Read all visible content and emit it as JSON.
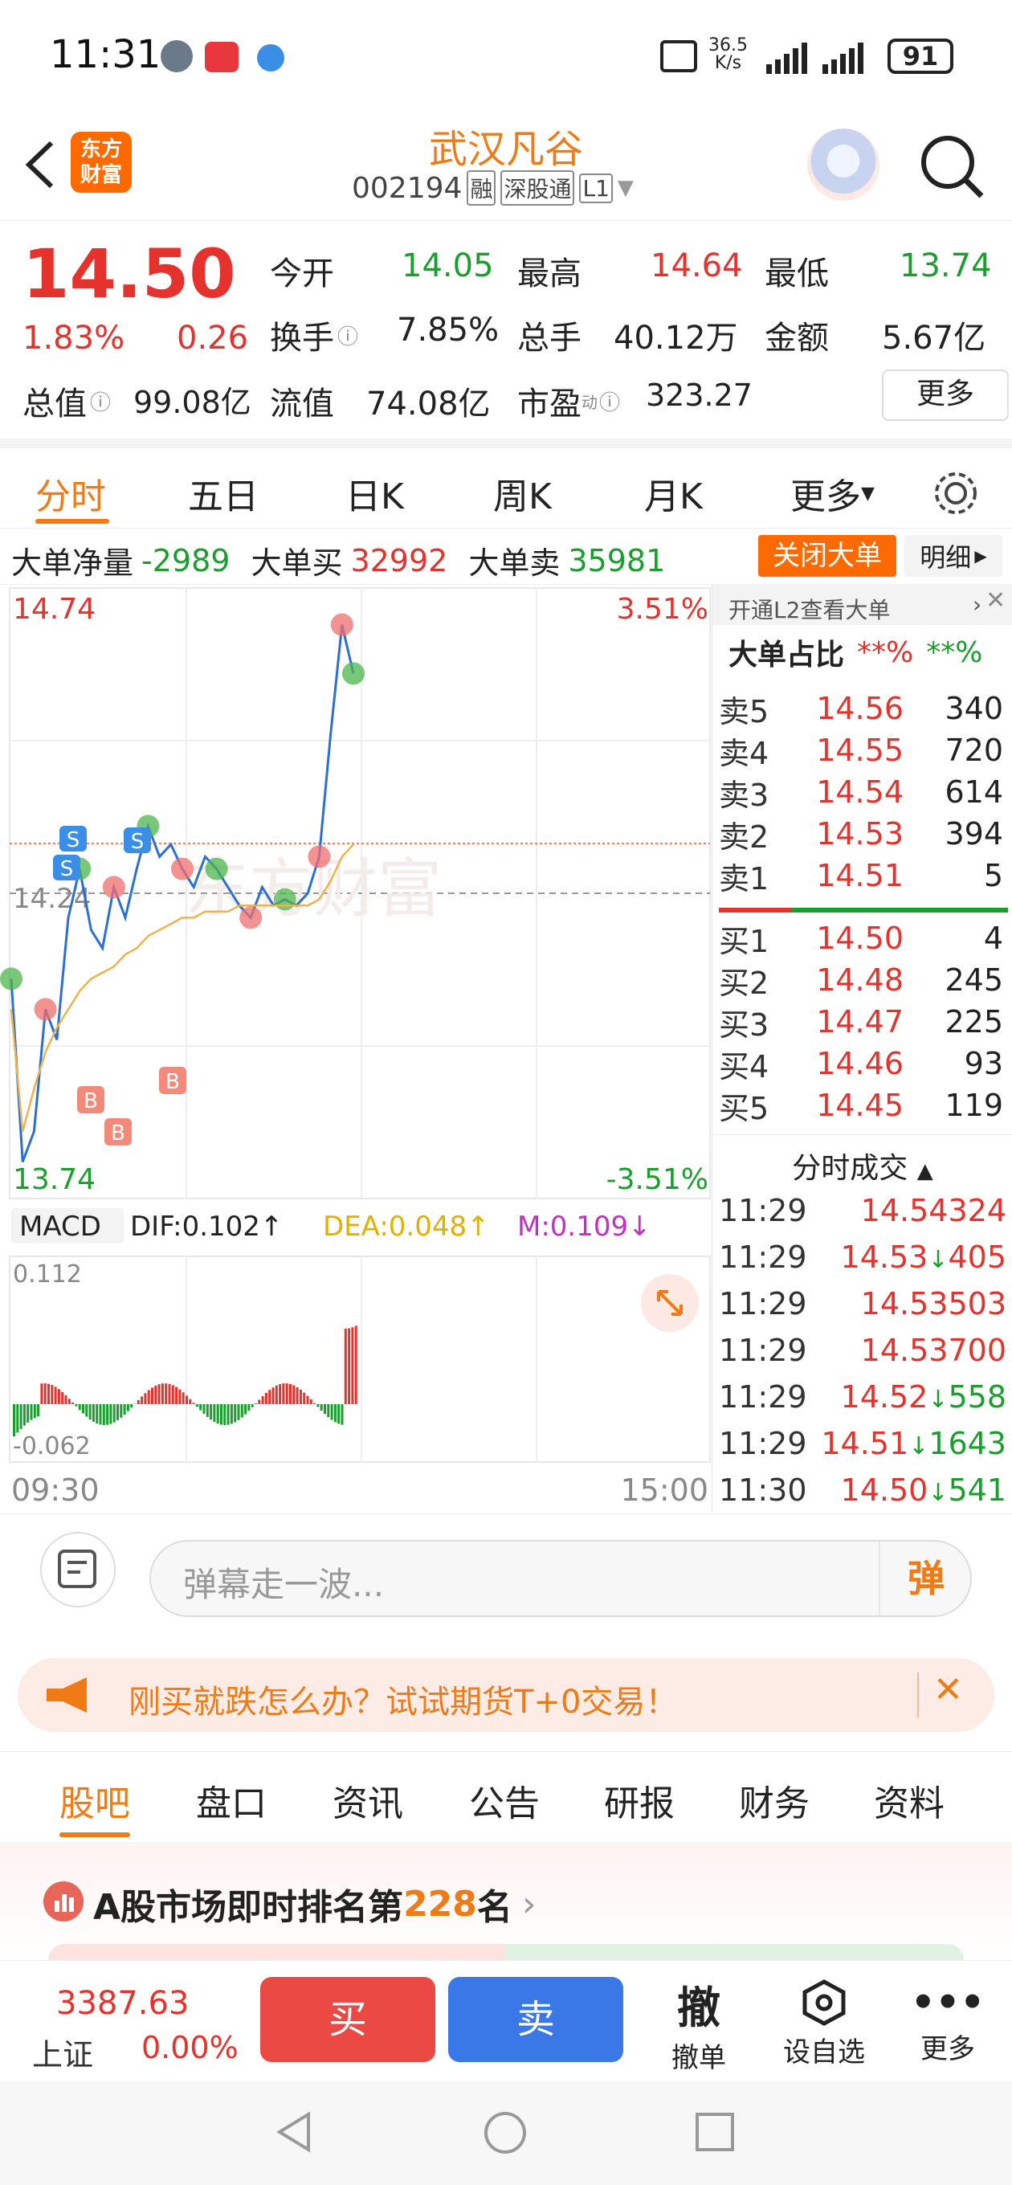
{
  "status": {
    "time": "11:31",
    "net_speed_top": "36.5",
    "net_speed_bottom": "K/s",
    "battery": "91"
  },
  "header": {
    "logo_line1": "东方",
    "logo_line2": "财富",
    "stock_name": "武汉凡谷",
    "stock_code": "002194",
    "tags": [
      "融",
      "深股通",
      "L1"
    ]
  },
  "quote": {
    "price": "14.50",
    "change_pct": "1.83%",
    "change": "0.26",
    "open_label": "今开",
    "open": "14.05",
    "high_label": "最高",
    "high": "14.64",
    "low_label": "最低",
    "low": "13.74",
    "turnover_label": "换手",
    "turnover": "7.85%",
    "volume_label": "总手",
    "volume": "40.12万",
    "amount_label": "金额",
    "amount": "5.67亿",
    "mktcap_label": "总值",
    "mktcap": "99.08亿",
    "float_label": "流值",
    "float": "74.08亿",
    "pe_label": "市盈",
    "pe_sup": "动",
    "pe": "323.27",
    "more": "更多"
  },
  "tabs": [
    "分时",
    "五日",
    "日K",
    "周K",
    "月K",
    "更多"
  ],
  "bigorder": {
    "net_label": "大单净量",
    "net": "-2989",
    "buy_label": "大单买",
    "buy": "32992",
    "sell_label": "大单卖",
    "sell": "35981",
    "close_btn": "关闭大单",
    "detail_btn": "明细"
  },
  "chart": {
    "high_label": "14.74",
    "low_label": "13.74",
    "high_pct": "3.51%",
    "low_pct": "-3.51%",
    "mid_label": "14.24",
    "watermark": "东方财富",
    "start_time": "09:30",
    "end_time": "15:00",
    "macd": {
      "name": "MACD",
      "dif": "DIF:0.102↑",
      "dea": "DEA:0.048↑",
      "m": "M:0.109↓",
      "top": "0.112",
      "bottom": "-0.062"
    },
    "markers": {
      "s": "S",
      "b": "B"
    }
  },
  "chart_data": {
    "type": "line",
    "title": "",
    "series": [
      {
        "values": [
          14.1,
          13.8,
          13.85,
          14.05,
          14.0,
          14.2,
          14.28,
          14.18,
          14.15,
          14.25,
          14.2,
          14.28,
          14.35,
          14.3,
          14.32,
          14.28,
          14.25,
          14.3,
          14.28,
          14.25,
          14.22,
          14.2,
          14.25,
          14.22,
          14.23,
          14.22,
          14.24,
          14.3,
          14.5,
          14.68,
          14.6
        ]
      },
      {
        "values": [
          14.05,
          13.85,
          13.92,
          13.98,
          14.02,
          14.05,
          14.08,
          14.1,
          14.11,
          14.12,
          14.14,
          14.15,
          14.17,
          14.18,
          14.19,
          14.2,
          14.2,
          14.21,
          14.21,
          14.21,
          14.22,
          14.22,
          14.22,
          14.22,
          14.22,
          14.22,
          14.22,
          14.23,
          14.26,
          14.3,
          14.32
        ]
      }
    ],
    "ylim": [
      13.74,
      14.74
    ]
  },
  "orderbook": {
    "l2_link": "开通L2查看大单",
    "ratio_label": "大单占比",
    "ratio_red": "**%",
    "ratio_green": "**%",
    "asks": [
      {
        "label": "卖5",
        "price": "14.56",
        "vol": "340"
      },
      {
        "label": "卖4",
        "price": "14.55",
        "vol": "720"
      },
      {
        "label": "卖3",
        "price": "14.54",
        "vol": "614"
      },
      {
        "label": "卖2",
        "price": "14.53",
        "vol": "394"
      },
      {
        "label": "卖1",
        "price": "14.51",
        "vol": "5"
      }
    ],
    "bids": [
      {
        "label": "买1",
        "price": "14.50",
        "vol": "4"
      },
      {
        "label": "买2",
        "price": "14.48",
        "vol": "245"
      },
      {
        "label": "买3",
        "price": "14.47",
        "vol": "225"
      },
      {
        "label": "买4",
        "price": "14.46",
        "vol": "93"
      },
      {
        "label": "买5",
        "price": "14.45",
        "vol": "119"
      }
    ],
    "trades_title": "分时成交",
    "trades": [
      {
        "t": "11:29",
        "p": "14.54",
        "arrow": "",
        "v": "324",
        "color": "#e5322d"
      },
      {
        "t": "11:29",
        "p": "14.53",
        "arrow": "↓",
        "v": "405",
        "color": "#e5322d"
      },
      {
        "t": "11:29",
        "p": "14.53",
        "arrow": "",
        "v": "503",
        "color": "#e5322d"
      },
      {
        "t": "11:29",
        "p": "14.53",
        "arrow": "",
        "v": "700",
        "color": "#e5322d"
      },
      {
        "t": "11:29",
        "p": "14.52",
        "arrow": "↓",
        "v": "558",
        "color": "#1a9e2e"
      },
      {
        "t": "11:29",
        "p": "14.51",
        "arrow": "↓",
        "v": "1643",
        "color": "#1a9e2e"
      },
      {
        "t": "11:30",
        "p": "14.50",
        "arrow": "↓",
        "v": "541",
        "color": "#1a9e2e"
      }
    ]
  },
  "danmu": {
    "placeholder": "弹幕走一波...",
    "btn": "弹"
  },
  "banner": {
    "text": "刚买就跌怎么办？试试期货T+0交易！"
  },
  "section_tabs": [
    "股吧",
    "盘口",
    "资讯",
    "公告",
    "研报",
    "财务",
    "资料"
  ],
  "rank": {
    "prefix": "A股市场即时排名第",
    "num": "228",
    "suffix": "名"
  },
  "bottom": {
    "index_value": "3387.63",
    "index_name": "上证",
    "index_change": "0.00%",
    "buy": "买",
    "sell": "卖",
    "cancel_icon": "撤",
    "cancel_label": "撤单",
    "watch_label": "设自选",
    "more_label": "更多"
  }
}
